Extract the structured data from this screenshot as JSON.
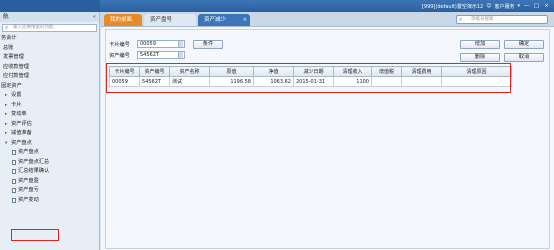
{
  "topbar": {
    "account": "[999](default)置空演示12",
    "customer_service": "客户服务",
    "min_icon": "—",
    "max_icon": "□",
    "close_icon": "×"
  },
  "tabs": [
    {
      "label": "我的桌面"
    },
    {
      "label": "资产盘号"
    },
    {
      "label": "资产减少"
    }
  ],
  "search": {
    "placeholder": "单据号搜索"
  },
  "sidebar": {
    "title": "航",
    "collapse": "«",
    "search_placeholder": "输入您要搜索的功能",
    "items": [
      {
        "label": "务会计",
        "level": 0
      },
      {
        "label": "总账",
        "level": 1
      },
      {
        "label": "发票管理",
        "level": 1
      },
      {
        "label": "应收款管理",
        "level": 1
      },
      {
        "label": "应付款管理",
        "level": 1
      },
      {
        "label": "固定资产",
        "level": 0
      },
      {
        "label": "设置",
        "level": 2,
        "arrow": "▸"
      },
      {
        "label": "卡片",
        "level": 2,
        "arrow": "▸"
      },
      {
        "label": "变动单",
        "level": 2,
        "arrow": "▸"
      },
      {
        "label": "资产评估",
        "level": 2,
        "arrow": "▸"
      },
      {
        "label": "减值准备",
        "level": 2,
        "arrow": "▸"
      },
      {
        "label": "资产盘点",
        "level": 2,
        "arrow": "▾"
      },
      {
        "label": "资产盘点",
        "level": 3
      },
      {
        "label": "资产盘点汇总",
        "level": 3
      },
      {
        "label": "汇总结果确认",
        "level": 3
      },
      {
        "label": "资产盘盈",
        "level": 3
      },
      {
        "label": "资产盘亏",
        "level": 3,
        "active": true
      },
      {
        "label": "资产变动",
        "level": 3
      }
    ]
  },
  "form": {
    "card_no_label": "卡片编号",
    "card_no_value": "00059",
    "asset_no_label": "资产编号",
    "asset_no_value": "54562T",
    "condition_button": "条件"
  },
  "buttons": {
    "add": "增加",
    "confirm": "确定",
    "delete": "删除",
    "cancel": "取消"
  },
  "table": {
    "headers": [
      "卡片编号",
      "资产编号",
      "资产名称",
      "原值",
      "净值",
      "减少日期",
      "清理收入",
      "增值税",
      "清理费用",
      "清理原因"
    ],
    "rows": [
      [
        "00059",
        "54562T",
        "测试",
        "1196.58",
        "1063.62",
        "2015-01-31",
        "1100",
        "",
        "",
        ""
      ]
    ]
  }
}
